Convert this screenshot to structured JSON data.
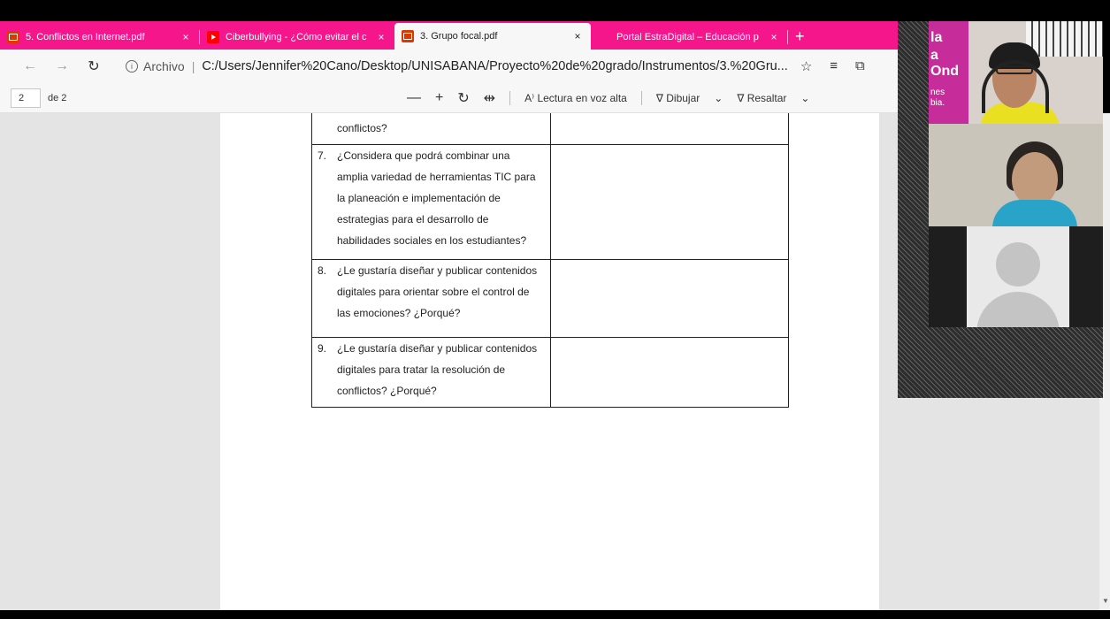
{
  "browser": {
    "tabs": [
      {
        "title": "5. Conflictos en Internet.pdf",
        "icon": "pdf-icon",
        "active": false
      },
      {
        "title": "Ciberbullying - ¿Cómo evitar el c",
        "icon": "youtube-icon",
        "active": false
      },
      {
        "title": "3. Grupo focal.pdf",
        "icon": "pdf-icon",
        "active": true
      },
      {
        "title": "Portal EstraDigital – Educación p",
        "icon": "portal-icon",
        "active": false
      }
    ],
    "close_glyph": "×",
    "new_tab_glyph": "+",
    "address": {
      "info_label": "Archivo",
      "separator": "|",
      "url": "C:/Users/Jennifer%20Cano/Desktop/UNISABANA/Proyecto%20de%20grado/Instrumentos/3.%20Gru..."
    }
  },
  "pdf_toolbar": {
    "page_current": "2",
    "page_total": "de 2",
    "zoom_out": "—",
    "zoom_in": "+",
    "read_aloud": "Lectura en voz alta",
    "draw": "Dibujar",
    "highlight": "Resaltar"
  },
  "document": {
    "rows": [
      {
        "number": "",
        "text": "estrategias en pro de la resolución de\nconflictos?"
      },
      {
        "number": "7.",
        "text": "¿Considera que podrá combinar una\namplia variedad de herramientas TIC para\nla planeación e implementación de\nestrategias para el desarrollo de\nhabilidades sociales en los estudiantes?"
      },
      {
        "number": "8.",
        "text": "¿Le gustaría diseñar y publicar contenidos\ndigitales para orientar sobre el control de\nlas emociones? ¿Porqué?"
      },
      {
        "number": "9.",
        "text": "¿Le gustaría diseñar y publicar contenidos\ndigitales para tratar la resolución de\nconflictos? ¿Porqué?"
      }
    ]
  },
  "video": {
    "banner_lines": [
      "la",
      "a Ond",
      "nes",
      "bia."
    ]
  },
  "colors": {
    "tab_bar": "#f5168c",
    "chrome": "#f7f7f7",
    "doc_background": "#e4e4e4",
    "banner": "#c72d9a"
  }
}
